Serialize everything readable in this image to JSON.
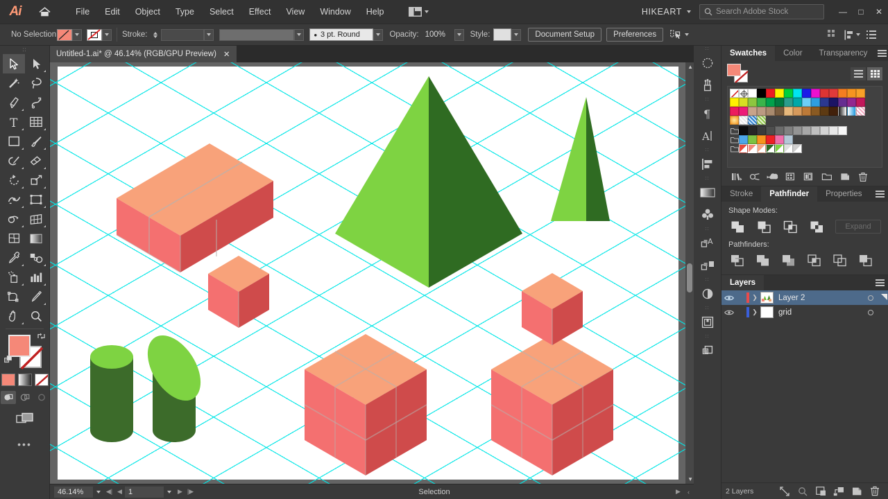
{
  "app": {
    "name": "Ai",
    "logo_color": "#ff9a76"
  },
  "menubar": {
    "items": [
      "File",
      "Edit",
      "Object",
      "Type",
      "Select",
      "Effect",
      "View",
      "Window",
      "Help"
    ],
    "arrange_icon": "arrange-documents-icon",
    "user": "HIKEART",
    "search_placeholder": "Search Adobe Stock",
    "window_buttons": {
      "minimize": "—",
      "maximize": "□",
      "close": "✕"
    }
  },
  "controlbar": {
    "selection_status": "No Selection",
    "fill_label": "fill-swatch",
    "fill_color": "#f58878",
    "stroke_label": "Stroke:",
    "stroke_value": "",
    "brush_label": "3 pt. Round",
    "opacity_label": "Opacity:",
    "opacity_value": "100%",
    "style_label": "Style:",
    "document_setup": "Document Setup",
    "preferences": "Preferences",
    "align_icon": "align-to-selection-icon"
  },
  "tab": {
    "title": "Untitled-1.ai* @ 46.14% (RGB/GPU Preview)",
    "close": "✕"
  },
  "toolbar": {
    "tools": [
      {
        "name": "selection-tool",
        "selected": true,
        "flyout": false
      },
      {
        "name": "direct-selection-tool",
        "selected": false,
        "flyout": true
      },
      {
        "name": "magic-wand-tool",
        "selected": false,
        "flyout": false
      },
      {
        "name": "lasso-tool",
        "selected": false,
        "flyout": false
      },
      {
        "name": "pen-tool",
        "selected": false,
        "flyout": true
      },
      {
        "name": "curvature-tool",
        "selected": false,
        "flyout": false
      },
      {
        "name": "type-tool",
        "selected": false,
        "flyout": true
      },
      {
        "name": "line-segment-tool",
        "selected": false,
        "flyout": true
      },
      {
        "name": "rectangle-tool",
        "selected": false,
        "flyout": true
      },
      {
        "name": "paintbrush-tool",
        "selected": false,
        "flyout": true
      },
      {
        "name": "shaper-tool",
        "selected": false,
        "flyout": true
      },
      {
        "name": "eraser-tool",
        "selected": false,
        "flyout": true
      },
      {
        "name": "rotate-tool",
        "selected": false,
        "flyout": true
      },
      {
        "name": "scale-tool",
        "selected": false,
        "flyout": true
      },
      {
        "name": "width-tool",
        "selected": false,
        "flyout": true
      },
      {
        "name": "free-transform-tool",
        "selected": false,
        "flyout": true
      },
      {
        "name": "shape-builder-tool",
        "selected": false,
        "flyout": true
      },
      {
        "name": "perspective-grid-tool",
        "selected": false,
        "flyout": true
      },
      {
        "name": "mesh-tool",
        "selected": false,
        "flyout": false
      },
      {
        "name": "gradient-tool",
        "selected": false,
        "flyout": false
      },
      {
        "name": "eyedropper-tool",
        "selected": false,
        "flyout": true
      },
      {
        "name": "blend-tool",
        "selected": false,
        "flyout": true
      },
      {
        "name": "symbol-sprayer-tool",
        "selected": false,
        "flyout": true
      },
      {
        "name": "column-graph-tool",
        "selected": false,
        "flyout": true
      },
      {
        "name": "artboard-tool",
        "selected": false,
        "flyout": false
      },
      {
        "name": "slice-tool",
        "selected": false,
        "flyout": true
      },
      {
        "name": "hand-tool",
        "selected": false,
        "flyout": true
      },
      {
        "name": "zoom-tool",
        "selected": false,
        "flyout": false
      }
    ],
    "fill_color": "#f58878",
    "stroke_color": "#ffffff",
    "color_modes": [
      "color-swatch",
      "gradient-swatch",
      "none-swatch"
    ],
    "draw_modes": [
      "draw-normal",
      "draw-behind",
      "draw-inside"
    ],
    "screen_mode": "change-screen-mode",
    "more_tools": "•••"
  },
  "statusbar": {
    "zoom": "46.14%",
    "page": "1",
    "status": "Selection"
  },
  "dock": {
    "items": [
      "brushes-icon",
      "symbols-icon",
      "paragraph-icon",
      "character-icon",
      "align-icon",
      "gradient-icon",
      "graphic-styles-icon",
      "appearance-text-icon",
      "appearance-icon",
      "transparency-icon",
      "artboards-icon",
      "layers-comp-icon"
    ]
  },
  "swatches_panel": {
    "tabs": [
      "Swatches",
      "Color",
      "Transparency"
    ],
    "active_tab": "Swatches",
    "fill_color": "#f58878",
    "view_list": "list-view-icon",
    "view_grid": "grid-view-icon",
    "rows": [
      [
        "none",
        "registration",
        "#ffffff",
        "#000000",
        "#ed1c24",
        "#fff200",
        "#00a651",
        "#00aeef",
        "#2e3192",
        "#ec008c",
        "#ed3237",
        "#ef4136",
        "#f57f20",
        "#f7941e",
        "#f99d1c"
      ],
      [
        "#fff100",
        "#d7df23",
        "#8dc63f",
        "#39b54a",
        "#00a14b",
        "#008040",
        "#00a79d",
        "#00a8a8",
        "#6dcff6",
        "#00aeef",
        "#2b388f",
        "#1b1464",
        "#662d91",
        "#92278f",
        "#c1272d"
      ],
      [
        "#ec1c5d",
        "#ec008c",
        "#c69c6d",
        "#c69c6d",
        "#a67c52",
        "#754c24",
        "#f7bc7c",
        "#e0a26a",
        "#c07d3e",
        "#8c5e2a",
        "#603913",
        "#42210b",
        "#gradw",
        "#gradb",
        "#patt1"
      ],
      [
        "#f7941e",
        "#patt2",
        "#patt3",
        "#patt4"
      ],
      [
        "folder",
        "#1a1a1a",
        "#2b2b2b",
        "#3a3a3a",
        "#4d4d4d",
        "#6b6b6b",
        "#8c8c8c",
        "#a6a6a6",
        "#bfbfbf",
        "#d4d4d4",
        "#e6e6e6",
        "#f2f2f2"
      ],
      [
        "folder",
        "#4da6e8",
        "#7dc242",
        "#f7941e",
        "#ed2024",
        "#f06eaa",
        "#b3c7d6"
      ],
      [
        "folder",
        "#sl1",
        "#sl2",
        "#sl3",
        "#sl4",
        "#sl5",
        "#sl6",
        "#sl7"
      ]
    ],
    "footer_icons": [
      "swatch-libraries-icon",
      "show-kinds-icon",
      "color-group-icon",
      "swatch-options-icon",
      "new-color-group-icon",
      "new-swatch-icon",
      "delete-swatch-icon"
    ]
  },
  "pathfinder_panel": {
    "tabs": [
      "Stroke",
      "Pathfinder",
      "Properties"
    ],
    "active_tab": "Pathfinder",
    "shape_modes_label": "Shape Modes:",
    "shape_modes": [
      "unite-icon",
      "minus-front-icon",
      "intersect-icon",
      "exclude-icon"
    ],
    "expand_label": "Expand",
    "pathfinders_label": "Pathfinders:",
    "pathfinders": [
      "divide-icon",
      "trim-icon",
      "merge-icon",
      "crop-icon",
      "outline-icon",
      "minus-back-icon"
    ]
  },
  "layers_panel": {
    "title": "Layers",
    "rows": [
      {
        "name": "Layer 2",
        "color": "#e84b4b",
        "selected": true,
        "visible": true,
        "thumb": "artwork"
      },
      {
        "name": "grid",
        "color": "#3a5fd9",
        "selected": false,
        "visible": true,
        "thumb": "blank"
      }
    ],
    "count_label": "2 Layers",
    "footer_icons": [
      "locate-object-icon",
      "make-clipping-mask-icon",
      "create-new-sublayer-icon",
      "create-new-layer-icon",
      "delete-selection-icon"
    ]
  },
  "artwork": {
    "description": "Isometric scene on cyan isometric grid",
    "grid_color": "#00e6e6",
    "palette": {
      "box_top": "#f8a27a",
      "box_left": "#f47070",
      "box_right": "#cf4b4b",
      "tree_light": "#7ed342",
      "tree_dark": "#2f6b22",
      "cyl_light": "#7ed342",
      "cyl_dark": "#3c6b2a"
    },
    "objects": [
      {
        "name": "long-beam",
        "type": "isometric-box",
        "color_group": "red"
      },
      {
        "name": "small-cube",
        "type": "isometric-box",
        "color_group": "red"
      },
      {
        "name": "large-pyramid",
        "type": "pyramid",
        "color_group": "green"
      },
      {
        "name": "small-pyramid",
        "type": "pyramid",
        "color_group": "green"
      },
      {
        "name": "cylinder-upright",
        "type": "cylinder",
        "color_group": "green"
      },
      {
        "name": "cylinder-tilted",
        "type": "cylinder",
        "color_group": "green"
      },
      {
        "name": "big-cube",
        "type": "isometric-box",
        "color_group": "red"
      },
      {
        "name": "stacked-cube-base",
        "type": "isometric-box",
        "color_group": "red"
      },
      {
        "name": "stacked-cube-top",
        "type": "isometric-box",
        "color_group": "red"
      }
    ]
  }
}
